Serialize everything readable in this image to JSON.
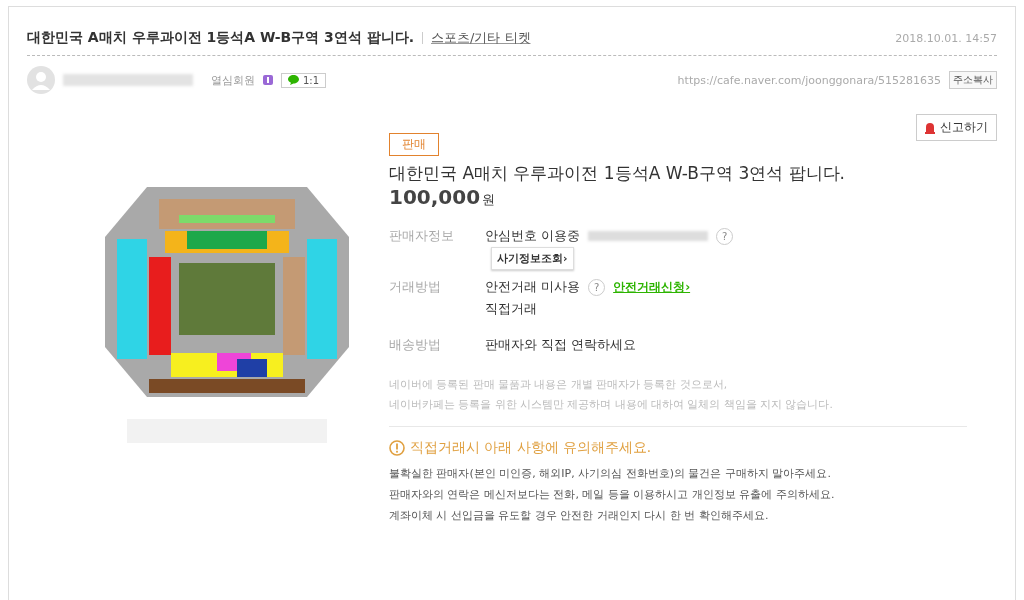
{
  "post": {
    "title": "대한민국 A매치 우루과이전 1등석A W-B구역 3연석 팝니다.",
    "category": "스포츠/기타 티켓",
    "date": "2018.10.01. 14:57"
  },
  "author": {
    "grade": "열심회원",
    "chat_count": "1:1",
    "url": "https://cafe.naver.com/joonggonara/515281635",
    "copy_button": "주소복사"
  },
  "report_button": "신고하기",
  "listing": {
    "badge": "판매",
    "title": "대한민국 A매치 우루과이전 1등석A W-B구역 3연석 팝니다.",
    "price": "100,000",
    "currency": "원"
  },
  "seller_info": {
    "label": "판매자정보",
    "value": "안심번호 이용중",
    "help": "?",
    "fraud_button": "사기정보조회›"
  },
  "trade_method": {
    "label": "거래방법",
    "value": "안전거래 미사용",
    "help": "?",
    "link": "안전거래신청›",
    "note": "직접거래"
  },
  "shipping": {
    "label": "배송방법",
    "value": "판매자와 직접 연락하세요"
  },
  "disclaimer": [
    "네이버에 등록된 판매 물품과 내용은 개별 판매자가 등록한 것으로서,",
    "네이버카페는 등록을 위한 시스템만 제공하며 내용에 대하여 일체의 책임을 지지 않습니다."
  ],
  "caution": {
    "title": "직접거래시 아래 사항에 유의해주세요.",
    "items": [
      "불확실한 판매자(본인 미인증, 해외IP, 사기의심 전화번호)의 물건은 구매하지 말아주세요.",
      "판매자와의 연락은 메신저보다는 전화, 메일 등을 이용하시고 개인정보 유출에 주의하세요.",
      "계좌이체 시 선입금을 유도할 경우 안전한 거래인지 다시 한 번 확인해주세요."
    ]
  }
}
